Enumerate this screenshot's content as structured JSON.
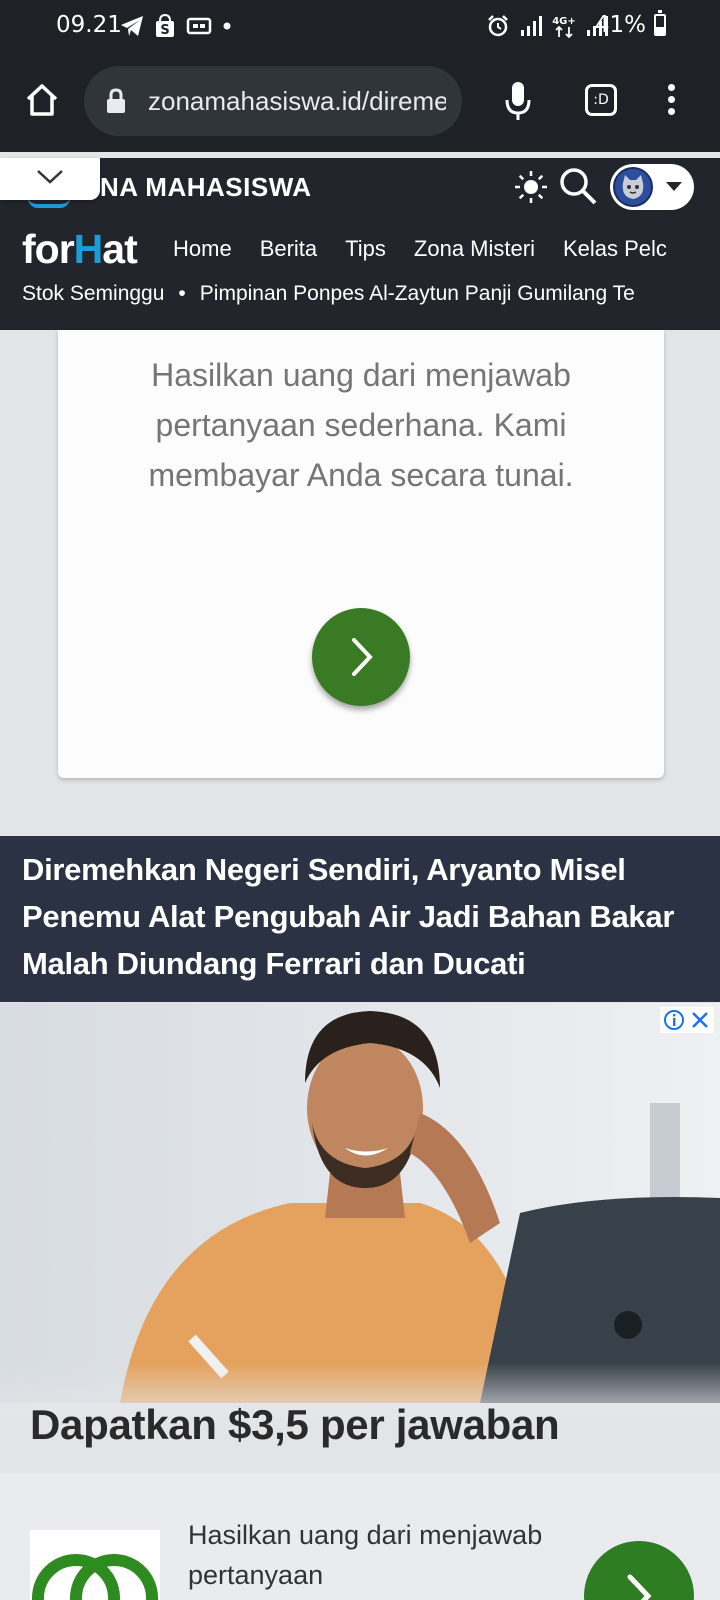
{
  "status_bar": {
    "time": "09.21",
    "battery": "41%",
    "battery_level": 0.41,
    "left_icons": [
      "telegram-icon",
      "shopee-icon",
      "cast-icon",
      "notification-dot-icon"
    ],
    "right_icons": [
      "alarm-icon",
      "signal-icon",
      "network-4g-icon",
      "signal-icon"
    ]
  },
  "browser": {
    "url": "zonamahasiswa.id/direme",
    "tabs_label": ":D",
    "icons": [
      "home-icon",
      "lock-icon",
      "mic-icon",
      "tabs-icon",
      "more-vert-icon"
    ]
  },
  "site_header": {
    "site_name": "NA MAHASISWA",
    "brand_prefix": "for",
    "brand_highlight": "H",
    "brand_suffix": "at",
    "nav": [
      "Home",
      "Berita",
      "Tips",
      "Zona Misteri",
      "Kelas Pelc"
    ],
    "ticker": [
      "Stok Seminggu",
      "Pimpinan Ponpes Al-Zaytun Panji Gumilang Te"
    ],
    "ticker_separator": "•",
    "accent_color": "#1e9bd7",
    "icons": [
      "chevron-down-icon",
      "sun-icon",
      "search-icon",
      "avatar",
      "caret-down-icon"
    ]
  },
  "ad_top": {
    "text": "Hasilkan uang dari menjawab pertanyaan sederhana. Kami membayar Anda secara tunai.",
    "button_color": "#3a7a25"
  },
  "article": {
    "headline": "Diremehkan Negeri Sendiri, Aryanto Misel Penemu Alat Pengubah Air Jadi Bahan Bakar Malah Diundang Ferrari dan Ducati",
    "bg_color": "#2a3244"
  },
  "ad_bottom": {
    "title": "Dapatkan $3,5 per jawaban",
    "text": "Hasilkan uang dari menjawab pertanyaan",
    "icons": [
      "adchoices-icon",
      "close-icon"
    ],
    "button_color": "#2f7d22"
  }
}
